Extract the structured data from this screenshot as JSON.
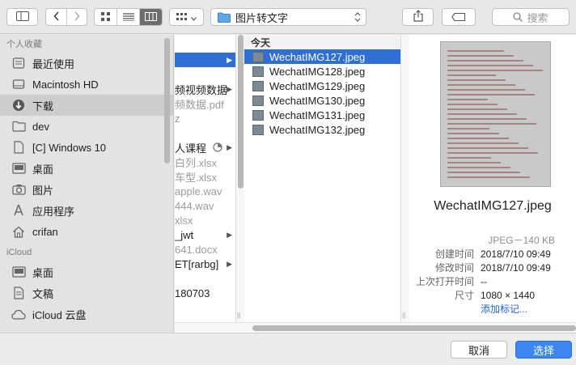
{
  "toolbar": {
    "path_label": "图片转文字",
    "search_placeholder": "搜索"
  },
  "sidebar": {
    "favorites_header": "个人收藏",
    "favorites": [
      {
        "label": "最近使用",
        "icon": "recents-icon"
      },
      {
        "label": "Macintosh HD",
        "icon": "hard-drive-icon"
      },
      {
        "label": "下载",
        "icon": "downloads-icon"
      },
      {
        "label": "dev",
        "icon": "folder-icon"
      },
      {
        "label": "[C] Windows 10",
        "icon": "document-icon"
      },
      {
        "label": "桌面",
        "icon": "desktop-icon"
      },
      {
        "label": "图片",
        "icon": "camera-icon"
      },
      {
        "label": "应用程序",
        "icon": "applications-icon"
      },
      {
        "label": "crifan",
        "icon": "home-icon"
      }
    ],
    "icloud_header": "iCloud",
    "icloud": [
      {
        "label": "桌面",
        "icon": "desktop-icon"
      },
      {
        "label": "文稿",
        "icon": "documents-icon"
      },
      {
        "label": "iCloud 云盘",
        "icon": "cloud-icon"
      }
    ]
  },
  "column1": [
    {
      "text": "",
      "selected": true
    },
    {
      "text": ""
    },
    {
      "text": "频视频数据",
      "dim": false,
      "arrow": true
    },
    {
      "text": "频数据.pdf",
      "dim": true
    },
    {
      "text": "z",
      "dim": true
    },
    {
      "text": ""
    },
    {
      "text": "人课程",
      "dim": false,
      "arrow": true
    },
    {
      "text": "白列.xlsx",
      "dim": true
    },
    {
      "text": "车型.xlsx",
      "dim": true
    },
    {
      "text": "apple.wav",
      "dim": true
    },
    {
      "text": "444.wav",
      "dim": true
    },
    {
      "text": "xlsx",
      "dim": true
    },
    {
      "text": "_jwt",
      "dim": false,
      "arrow": true
    },
    {
      "text": "641.docx",
      "dim": true
    },
    {
      "text": "ET[rarbg]",
      "dim": false,
      "arrow": true
    },
    {
      "text": ""
    },
    {
      "text": "180703",
      "dim": false
    }
  ],
  "column2": {
    "header": "今天",
    "files": [
      "WechatIMG127.jpeg",
      "WechatIMG128.jpeg",
      "WechatIMG129.jpeg",
      "WechatIMG130.jpeg",
      "WechatIMG131.jpeg",
      "WechatIMG132.jpeg"
    ],
    "selected_index": 0
  },
  "preview": {
    "name": "WechatIMG127.jpeg",
    "kind": "JPEG－140 KB",
    "meta": [
      {
        "key": "创建时间",
        "value": "2018/7/10 09:49"
      },
      {
        "key": "修改时间",
        "value": "2018/7/10 09:49"
      },
      {
        "key": "上次打开时间",
        "value": "--"
      },
      {
        "key": "尺寸",
        "value": "1080 × 1440"
      }
    ],
    "add_tags": "添加标记..."
  },
  "buttons": {
    "cancel": "取消",
    "choose": "选择"
  },
  "colors": {
    "selection": "#2f6fd4",
    "primary_button": "#3b86f2"
  }
}
